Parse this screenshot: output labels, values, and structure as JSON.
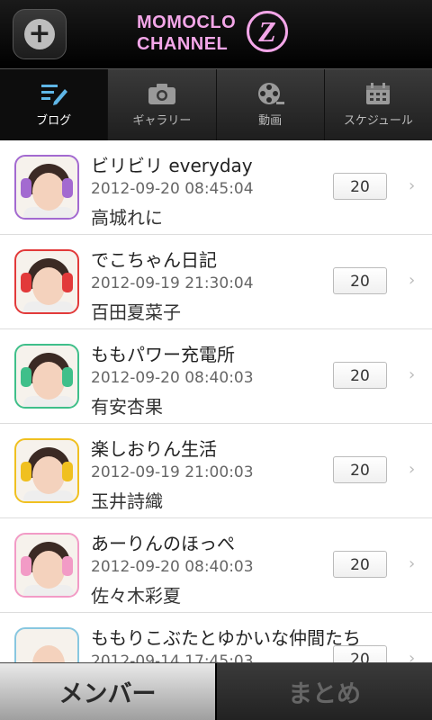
{
  "header": {
    "logo_line1": "MOMOCLO",
    "logo_line2": "CHANNEL",
    "logo_mark": "Z",
    "logo_color": "#f3a6e8",
    "add_icon": "plus-circle-icon"
  },
  "tabs": [
    {
      "label": "ブログ",
      "icon": "pencil-note-icon",
      "active": true
    },
    {
      "label": "ギャラリー",
      "icon": "camera-icon",
      "active": false
    },
    {
      "label": "動画",
      "icon": "film-reel-icon",
      "active": false
    },
    {
      "label": "スケジュール",
      "icon": "calendar-icon",
      "active": false
    }
  ],
  "posts": [
    {
      "title": "ビリビリ everyday",
      "date": "2012-09-20 08:45:04",
      "author": "高城れに",
      "count": "20",
      "accent": "#a36ad0"
    },
    {
      "title": "でこちゃん日記",
      "date": "2012-09-19 21:30:04",
      "author": "百田夏菜子",
      "count": "20",
      "accent": "#e23a3a"
    },
    {
      "title": "ももパワー充電所",
      "date": "2012-09-20 08:40:03",
      "author": "有安杏果",
      "count": "20",
      "accent": "#3fbf8a"
    },
    {
      "title": "楽しおりん生活",
      "date": "2012-09-19 21:00:03",
      "author": "玉井詩織",
      "count": "20",
      "accent": "#f0c020"
    },
    {
      "title": "あーりんのほっぺ",
      "date": "2012-09-20 08:40:03",
      "author": "佐々木彩夏",
      "count": "20",
      "accent": "#f29bc6"
    },
    {
      "title": "ももりこぶたとゆかいな仲間たち",
      "date": "2012-09-14 17:45:03",
      "author": "",
      "count": "20",
      "accent": "#88c7e0"
    }
  ],
  "bottom": {
    "members_label": "メンバー",
    "summary_label": "まとめ"
  }
}
